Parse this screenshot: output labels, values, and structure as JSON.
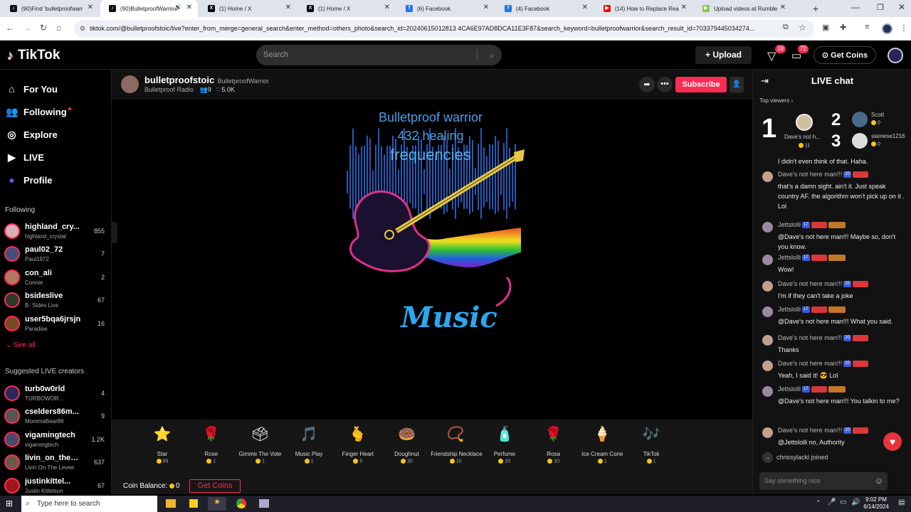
{
  "browser": {
    "tabs": [
      {
        "label": "(90)Find 'bulletproofwarr",
        "icon": "tiktok",
        "active": false
      },
      {
        "label": "(90)BulletproofWarrio",
        "icon": "tiktok",
        "active": true
      },
      {
        "label": "(1) Home / X",
        "icon": "x",
        "active": false
      },
      {
        "label": "(1) Home / X",
        "icon": "x",
        "active": false
      },
      {
        "label": "(6) Facebook",
        "icon": "facebook",
        "active": false
      },
      {
        "label": "(4) Facebook",
        "icon": "facebook",
        "active": false
      },
      {
        "label": "(14) How to Replace Rea",
        "icon": "youtube",
        "active": false
      },
      {
        "label": "Upload videos at Rumble",
        "icon": "rumble",
        "active": false
      }
    ],
    "url": "tiktok.com/@bulletproofstoic/live?enter_from_merge=general_search&enter_method=others_photo&search_id=20240615012813 4CA6E97AD8DCA11E3F87&search_keyword=bulletproofwarrior&search_result_id=703379445034274..."
  },
  "header": {
    "logo": "TikTok",
    "search_placeholder": "Search",
    "upload": "Upload",
    "inbox_badge": "18",
    "messages_badge": "72",
    "get_coins": "Get Coins"
  },
  "sidebar": {
    "nav": [
      {
        "label": "For You",
        "icon": "home-icon"
      },
      {
        "label": "Following",
        "icon": "following-icon"
      },
      {
        "label": "Explore",
        "icon": "compass-icon"
      },
      {
        "label": "LIVE",
        "icon": "live-icon"
      },
      {
        "label": "Profile",
        "icon": "profile-icon"
      }
    ],
    "following_title": "Following",
    "following": [
      {
        "name": "highland_cry...",
        "sub": "highland_crystal",
        "count": "855"
      },
      {
        "name": "paul02_72",
        "sub": "Paul1972",
        "count": "7"
      },
      {
        "name": "con_ali",
        "sub": "Connie",
        "count": "2"
      },
      {
        "name": "bsideslive",
        "sub": "B- Sides Live",
        "count": "67"
      },
      {
        "name": "user5bqa6jrsjn",
        "sub": "Paradise",
        "count": "16"
      }
    ],
    "see_all": "See all",
    "suggested_title": "Suggested LIVE creators",
    "suggested": [
      {
        "name": "turb0w0rld",
        "sub": "TURBOWOR...",
        "count": "4"
      },
      {
        "name": "cselders86m...",
        "sub": "MommaBear86",
        "count": "9"
      },
      {
        "name": "vigamingtech",
        "sub": "vigamingtech",
        "count": "1.2K"
      },
      {
        "name": "livin_on_the_l...",
        "sub": "Livin On The Levee",
        "count": "637"
      },
      {
        "name": "justinkittel...",
        "sub": "Justin Kittelson",
        "count": "67"
      }
    ]
  },
  "streamer": {
    "username": "bulletproofstoic",
    "nickname": "BulletproofWarrior",
    "subtitle": "Bulletproof Radio",
    "viewers": "9",
    "likes": "5.0K",
    "subscribe": "Subscribe"
  },
  "video": {
    "line1": "Bulletproof warrior",
    "line2": "432 healing",
    "line3": "frequencies",
    "word": "Music"
  },
  "gifts": [
    {
      "name": "Star",
      "price": "99",
      "emoji": "⭐",
      "color": "#f5d020"
    },
    {
      "name": "Rose",
      "price": "1",
      "emoji": "🌹",
      "color": "#e0243c"
    },
    {
      "name": "Gimme The Vote",
      "price": "1",
      "emoji": "🗳",
      "color": "#3ad0e0"
    },
    {
      "name": "Music Play",
      "price": "1",
      "emoji": "🎵",
      "color": "#40c8e8"
    },
    {
      "name": "Finger Heart",
      "price": "5",
      "emoji": "🫰",
      "color": "#f0a070"
    },
    {
      "name": "Doughnut",
      "price": "30",
      "emoji": "🍩",
      "color": "#f080b0"
    },
    {
      "name": "Friendship Necklace",
      "price": "10",
      "emoji": "📿",
      "color": "#c06040"
    },
    {
      "name": "Perfume",
      "price": "20",
      "emoji": "🧴",
      "color": "#f07080"
    },
    {
      "name": "Rosa",
      "price": "10",
      "emoji": "🌹",
      "color": "#e02040"
    },
    {
      "name": "Ice Cream Cone",
      "price": "1",
      "emoji": "🍦",
      "color": "#f0a0c0"
    },
    {
      "name": "TikTok",
      "price": "1",
      "emoji": "🎶",
      "color": "#c0a0f0"
    }
  ],
  "coin_balance_label": "Coin Balance:",
  "coin_balance": "0",
  "get_coins_btn": "Get Coins",
  "chat": {
    "title": "LIVE chat",
    "top_viewers": "Top viewers",
    "top": [
      {
        "rank": "1",
        "name": "Dave's not h...",
        "coins": "11"
      },
      {
        "rank": "2",
        "name": "Scott",
        "coins": "0"
      },
      {
        "rank": "3",
        "name": "siamese1216",
        "coins": "0"
      }
    ],
    "first_line": "I didn't even think of that. Haha.",
    "messages": [
      {
        "user": "Dave's not here man!!!",
        "lvl": "20",
        "text": "that's a damn sight. ain't it. Just speak country AF. the algorithm won't pick up on it . Lol"
      },
      {
        "user": "Jettslolli",
        "lvl": "17",
        "text": "@Dave's not here man!!! Maybe so, don't you know."
      },
      {
        "user": "Jettslolli",
        "lvl": "17",
        "text": "Wow!"
      },
      {
        "user": "Dave's not here man!!!",
        "lvl": "20",
        "text": "I'm if they can't take a joke"
      },
      {
        "user": "Jettslolli",
        "lvl": "17",
        "text": "@Dave's not here man!!! What you said."
      },
      {
        "user": "Dave's not here man!!!",
        "lvl": "20",
        "text": "Thanks"
      },
      {
        "user": "Dave's not here man!!!",
        "lvl": "20",
        "text": "Yeah, I said it! 😎 Lol"
      },
      {
        "user": "Jettslolli",
        "lvl": "17",
        "text": "@Dave's not here man!!! You talkin to me?"
      },
      {
        "user": "Dave's not here man!!!",
        "lvl": "20",
        "text": "@Jettslolli no, Authority"
      }
    ],
    "joined": "chrissylackl joined",
    "input_placeholder": "Say something nice"
  },
  "taskbar": {
    "search": "Type here to search",
    "time": "9:02 PM",
    "date": "6/14/2024"
  }
}
